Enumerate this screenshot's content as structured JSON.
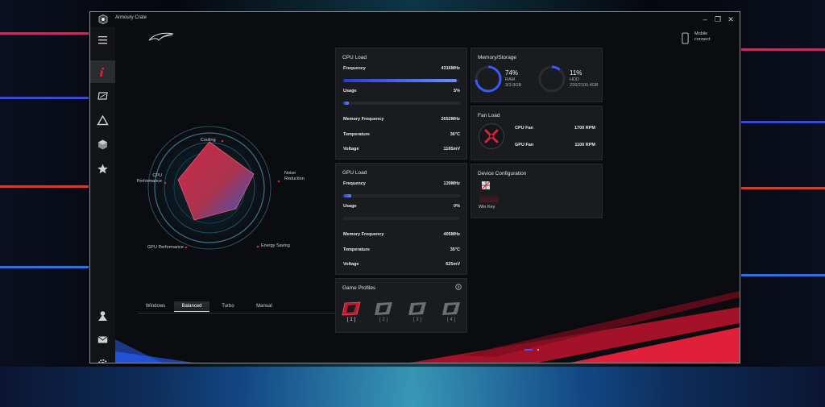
{
  "window": {
    "title": "Armoury Crate"
  },
  "header": {
    "mobile_connect_line1": "Mobile",
    "mobile_connect_line2": "connect"
  },
  "radar": {
    "labels": {
      "cooling": "Cooling",
      "noise_line1": "Noise",
      "noise_line2": "Reduction",
      "energy": "Energy Saving",
      "gpu": "GPU Performance",
      "cpu_line1": "CPU",
      "cpu_line2": "Performance"
    }
  },
  "modes": {
    "items": [
      "Windows",
      "Balanced",
      "Turbo",
      "Manual"
    ],
    "selected": "Balanced"
  },
  "cpu": {
    "title": "CPU Load",
    "frequency_label": "Frequency",
    "frequency_value": "4316MHz",
    "frequency_fill": 0.97,
    "usage_label": "Usage",
    "usage_value": "5%",
    "usage_fill": 0.05,
    "mem_freq_label": "Memory Frequency",
    "mem_freq_value": "2652MHz",
    "temp_label": "Temperature",
    "temp_value": "36°C",
    "voltage_label": "Voltage",
    "voltage_value": "1165mV"
  },
  "gpu": {
    "title": "GPU Load",
    "frequency_label": "Frequency",
    "frequency_value": "139MHz",
    "frequency_fill": 0.07,
    "usage_label": "Usage",
    "usage_value": "0%",
    "usage_fill": 0.0,
    "mem_freq_label": "Memory Frequency",
    "mem_freq_value": "405MHz",
    "temp_label": "Temperature",
    "temp_value": "35°C",
    "voltage_label": "Voltage",
    "voltage_value": "625mV"
  },
  "memory": {
    "title": "Memory/Storage",
    "ram_percent": "74%",
    "ram_label": "RAM",
    "ram_detail": "3/3.9GB",
    "ram_fill": 0.74,
    "hdd_percent": "11%",
    "hdd_label": "HDD",
    "hdd_detail": "226/2100.4GB",
    "hdd_fill": 0.11
  },
  "fan": {
    "title": "Fan Load",
    "cpu_fan_label": "CPU Fan",
    "cpu_fan_value": "1700  RPM",
    "gpu_fan_label": "GPU Fan",
    "gpu_fan_value": "1100  RPM"
  },
  "device": {
    "title": "Device Configuration",
    "win_key_label": "Win Key"
  },
  "profiles": {
    "title": "Game Profiles",
    "items": [
      "[ 1 ]",
      "[ 2 ]",
      "[ 3 ]",
      "[ 4 ]"
    ],
    "selected": 0
  },
  "icons": {
    "sidebar": [
      "info-icon",
      "monitor-icon",
      "aura-icon",
      "device-cube-icon",
      "featured-star-icon",
      "user-icon",
      "mail-icon",
      "settings-gear-icon"
    ]
  },
  "colors": {
    "accent_red": "#e0203a",
    "accent_blue": "#3a59ff",
    "accent_cyan": "#5cc8e8"
  }
}
